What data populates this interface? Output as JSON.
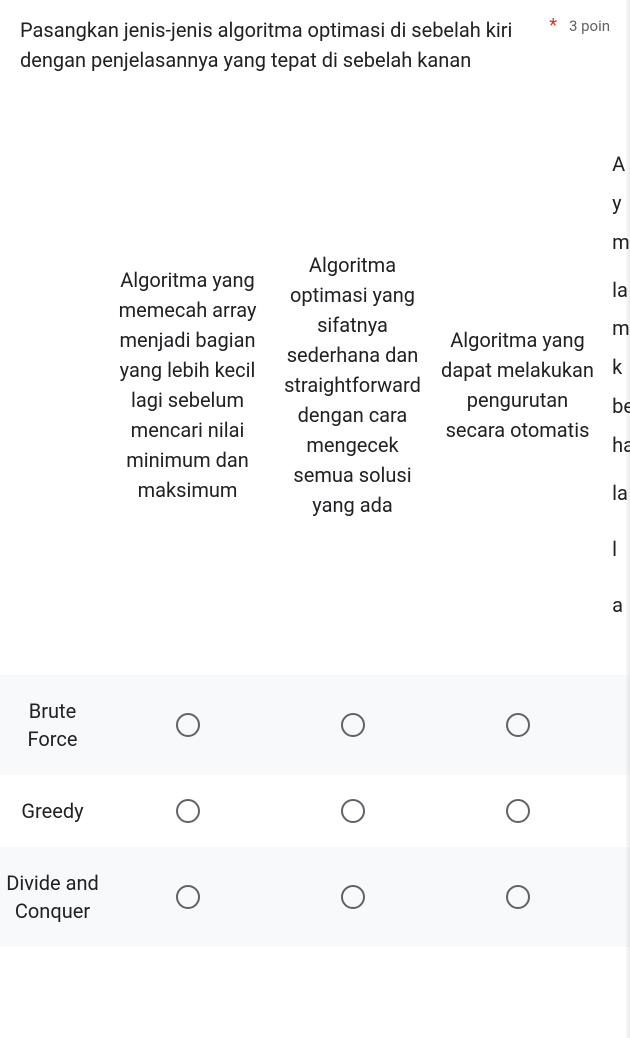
{
  "question": {
    "text": "Pasangkan jenis-jenis algoritma optimasi di sebelah kiri dengan penjelasannya yang tepat di sebelah kanan",
    "required_marker": "*",
    "points": "3 poin"
  },
  "columns": [
    "Algoritma yang memecah array menjadi bagian yang lebih kecil lagi sebelum mencari nilai minimum dan maksimum",
    "Algoritma optimasi yang sifatnya sederhana dan straightforward dengan cara mengecek semua solusi yang ada",
    "Algoritma yang dapat melakukan pengurutan secara otomatis"
  ],
  "partial_column_fragments": [
    "A",
    "y",
    "m",
    "",
    "la",
    "m",
    "k",
    "be",
    "ha",
    "",
    "la",
    "",
    "",
    "l",
    "",
    "",
    "a"
  ],
  "rows": [
    "Brute Force",
    "Greedy",
    "Divide and Conquer"
  ]
}
